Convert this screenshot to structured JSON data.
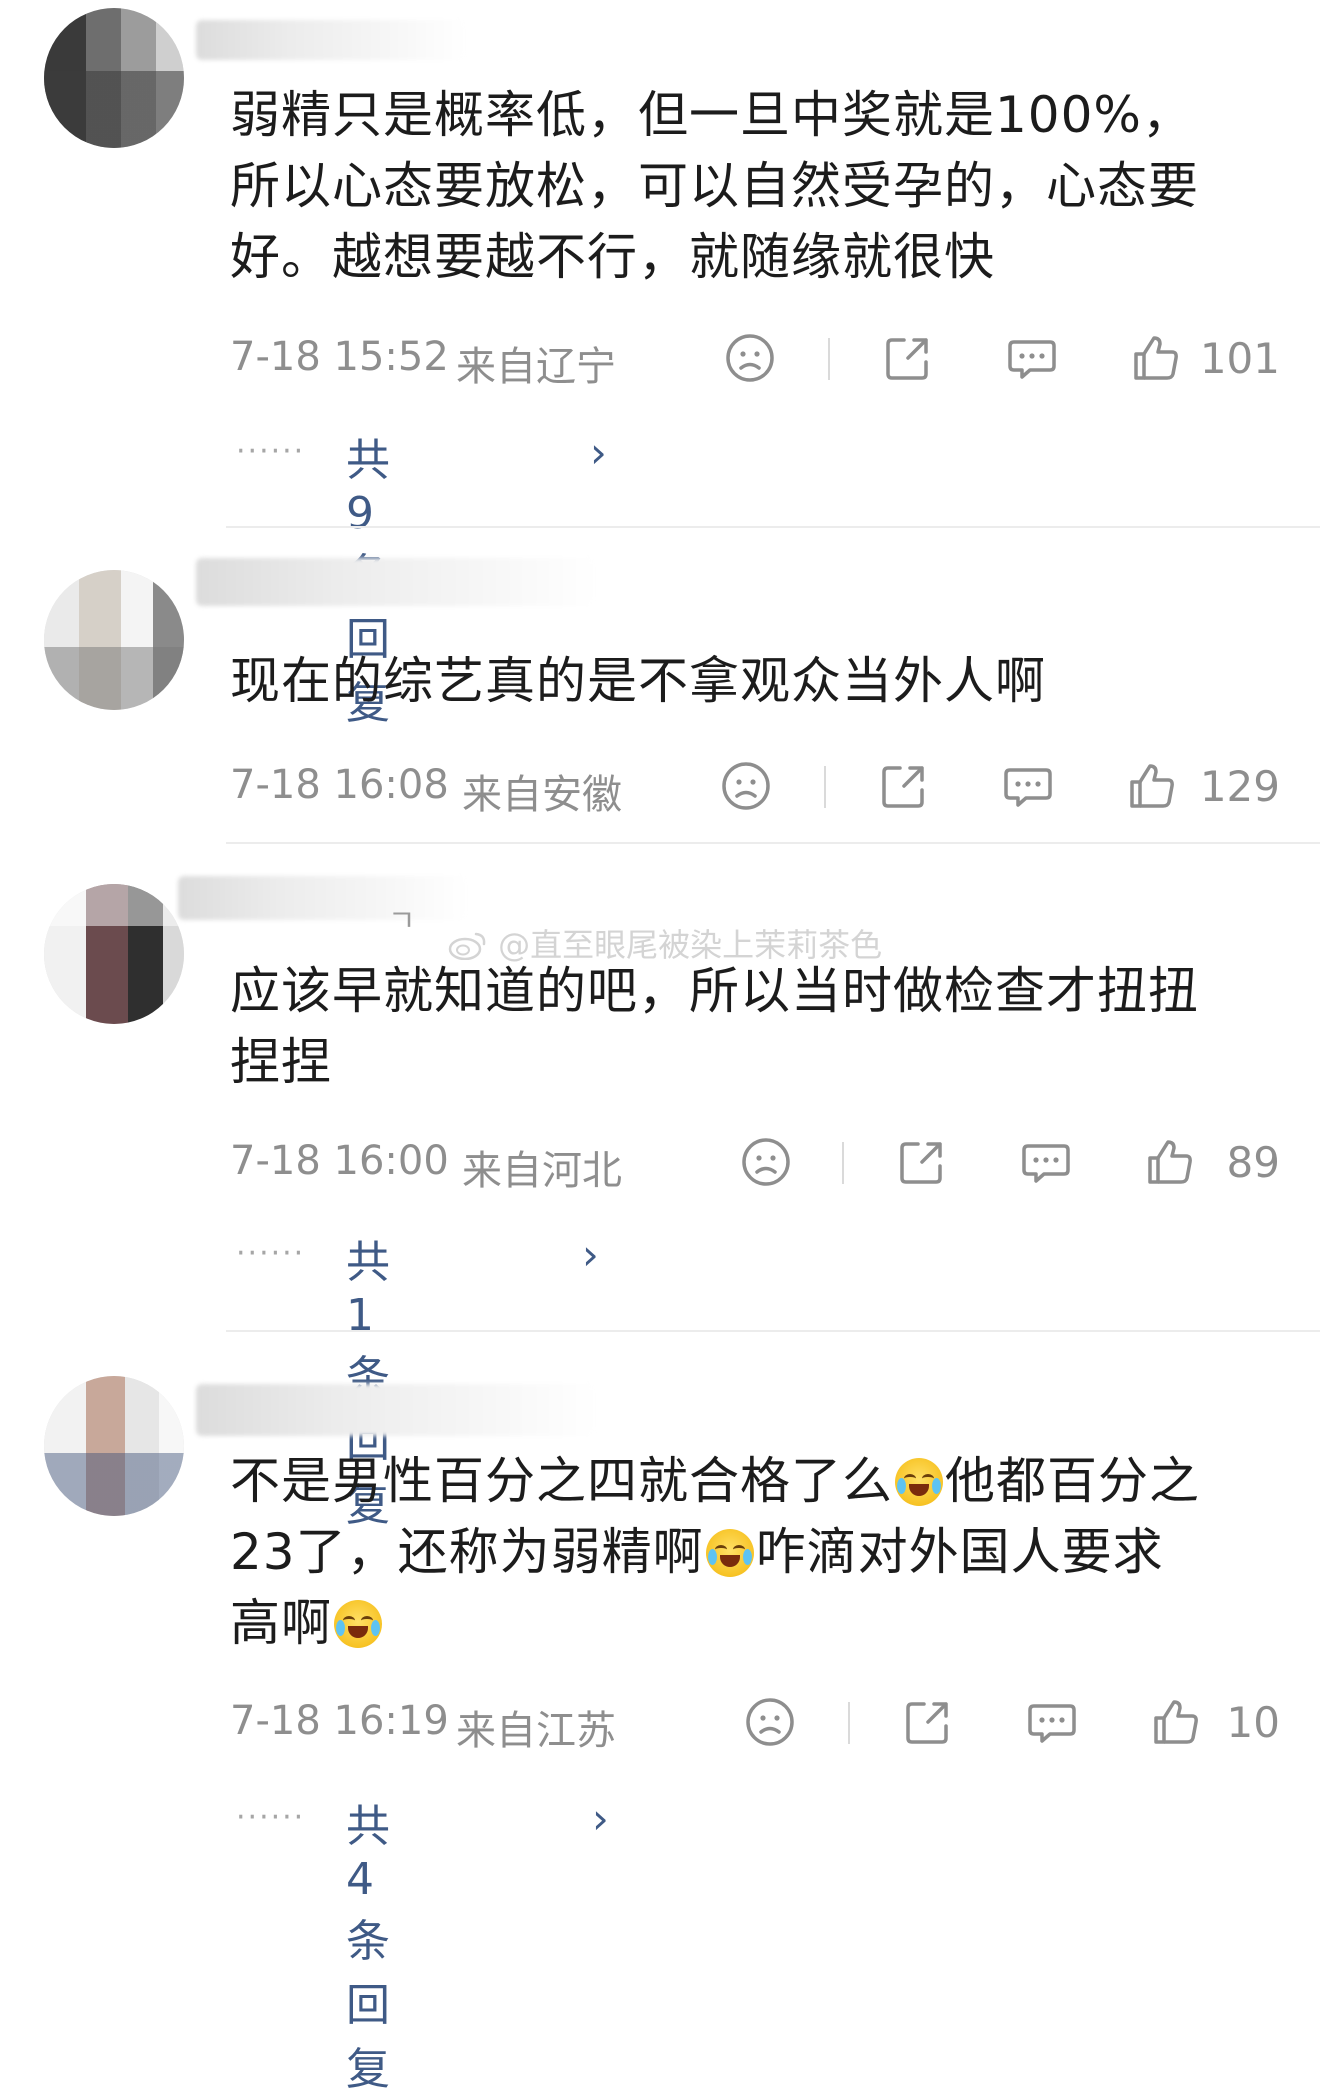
{
  "watermark": "@直至眼尾被染上茉莉茶色",
  "comments": [
    {
      "text": "弱精只是概率低，但一旦中奖就是100%，\n所以心态要放松，可以自然受孕的，心态要\n好。越想要越不行，就随缘就很快",
      "time": "7-18 15:52",
      "location": "来自辽宁",
      "likes": "101",
      "replies": "共9条回复"
    },
    {
      "text": "现在的综艺真的是不拿观众当外人啊",
      "time": "7-18 16:08",
      "location": "来自安徽",
      "likes": "129"
    },
    {
      "text": "应该早就知道的吧，所以当时做检查才扭扭\n捏捏",
      "time": "7-18 16:00",
      "location": "来自河北",
      "likes": "89",
      "replies": "共1条回复"
    },
    {
      "text_segments": [
        "不是男性百分之四就合格了么",
        "他都百分之\n23了，还称为弱精啊",
        "咋滴对外国人要求\n高啊",
        ""
      ],
      "time": "7-18 16:19",
      "location": "来自江苏",
      "likes": "10",
      "replies": "共4条回复"
    }
  ],
  "icons": {
    "dislike": "sad-face-icon",
    "share": "share-icon",
    "comment": "comment-bubble-icon",
    "like": "thumbs-up-icon",
    "emoji": "laugh-cry-emoji"
  },
  "colors": {
    "text": "#1c1c1c",
    "meta": "#8e8e8e",
    "reply_link": "#3f5a86",
    "divider": "#ececec"
  },
  "handle_fragment": "ㄱ"
}
